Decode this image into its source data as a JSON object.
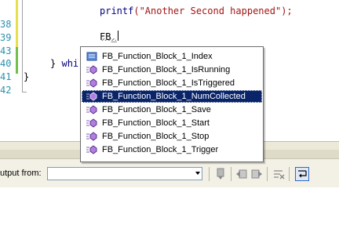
{
  "editor": {
    "line_numbers": [
      "38",
      "39",
      "40",
      "41",
      "42",
      "43"
    ],
    "code": {
      "printf_kw": "printf",
      "printf_args": "(\"Another Second happened\");",
      "typed_prefix": "FB_",
      "while_brace": "}",
      "while_kw": "whi",
      "close_brace": "}"
    }
  },
  "intellisense": {
    "items": [
      {
        "label": "FB_Function_Block_1_Index",
        "icon": "enum-member-icon"
      },
      {
        "label": "FB_Function_Block_1_IsRunning",
        "icon": "method-icon"
      },
      {
        "label": "FB_Function_Block_1_IsTriggered",
        "icon": "method-icon"
      },
      {
        "label": "FB_Function_Block_1_NumCollected",
        "icon": "method-icon"
      },
      {
        "label": "FB_Function_Block_1_Save",
        "icon": "method-icon"
      },
      {
        "label": "FB_Function_Block_1_Start",
        "icon": "method-icon"
      },
      {
        "label": "FB_Function_Block_1_Stop",
        "icon": "method-icon"
      },
      {
        "label": "FB_Function_Block_1_Trigger",
        "icon": "method-icon"
      }
    ],
    "selected_index": 3
  },
  "output": {
    "label": "utput from:",
    "source_value": ""
  }
}
